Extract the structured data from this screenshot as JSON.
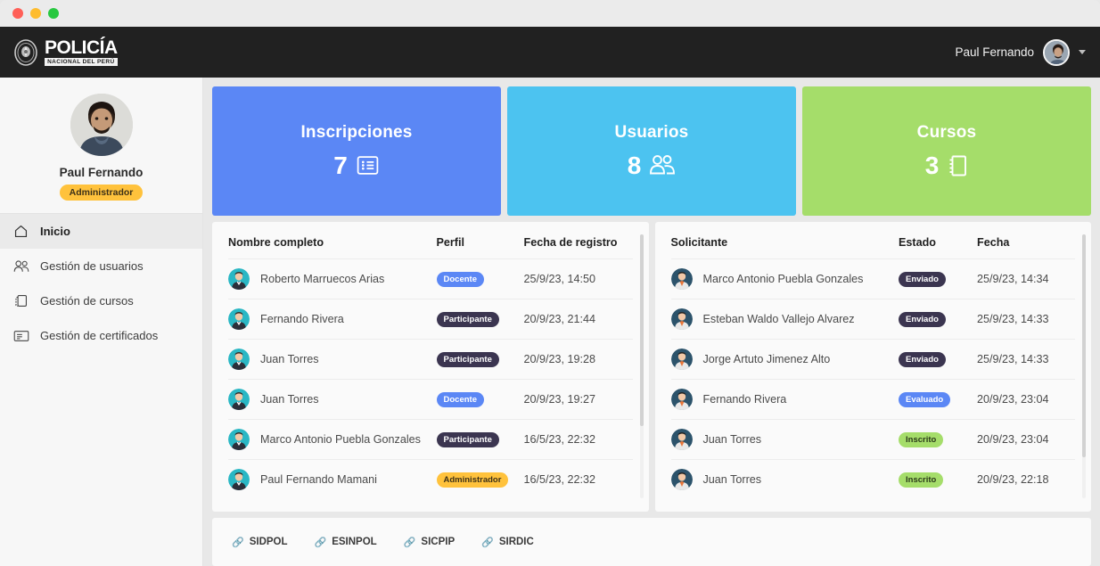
{
  "window": {
    "traffic_lights": [
      "close",
      "minimize",
      "maximize"
    ]
  },
  "topbar": {
    "brand_main": "POLICÍA",
    "brand_sub": "NACIONAL DEL PERÚ",
    "crest_icon": "police-crest-icon",
    "user_name": "Paul Fernando",
    "avatar_icon": "user-avatar",
    "caret_icon": "chevron-down-icon"
  },
  "sidebar": {
    "profile": {
      "avatar_icon": "profile-photo",
      "name": "Paul Fernando",
      "role": "Administrador"
    },
    "items": [
      {
        "label": "Inicio",
        "icon": "home-icon",
        "active": true
      },
      {
        "label": "Gestión de usuarios",
        "icon": "users-icon",
        "active": false
      },
      {
        "label": "Gestión de cursos",
        "icon": "copy-icon",
        "active": false
      },
      {
        "label": "Gestión de certificados",
        "icon": "certificate-icon",
        "active": false
      }
    ]
  },
  "cards": [
    {
      "title": "Inscripciones",
      "value": "7",
      "icon": "list-card-icon",
      "color": "#5b87f5"
    },
    {
      "title": "Usuarios",
      "value": "8",
      "icon": "users-group-icon",
      "color": "#4cc3f0"
    },
    {
      "title": "Cursos",
      "value": "3",
      "icon": "notebook-icon",
      "color": "#a5dd6a"
    }
  ],
  "users_panel": {
    "headers": [
      "Nombre completo",
      "Perfil",
      "Fecha de registro"
    ],
    "rows": [
      {
        "name": "Roberto Marruecos Arias",
        "perfil": "Docente",
        "perfil_class": "b-docente",
        "fecha": "25/9/23, 14:50"
      },
      {
        "name": "Fernando Rivera",
        "perfil": "Participante",
        "perfil_class": "b-part",
        "fecha": "20/9/23, 21:44"
      },
      {
        "name": "Juan Torres",
        "perfil": "Participante",
        "perfil_class": "b-part",
        "fecha": "20/9/23, 19:28"
      },
      {
        "name": "Juan Torres",
        "perfil": "Docente",
        "perfil_class": "b-docente",
        "fecha": "20/9/23, 19:27"
      },
      {
        "name": "Marco Antonio Puebla Gonzales",
        "perfil": "Participante",
        "perfil_class": "b-part",
        "fecha": "16/5/23, 22:32"
      },
      {
        "name": "Paul Fernando Mamani",
        "perfil": "Administrador",
        "perfil_class": "b-admin",
        "fecha": "16/5/23, 22:32"
      }
    ]
  },
  "requests_panel": {
    "headers": [
      "Solicitante",
      "Estado",
      "Fecha"
    ],
    "rows": [
      {
        "name": "Marco Antonio Puebla Gonzales",
        "estado": "Enviado",
        "estado_class": "b-enviado",
        "fecha": "25/9/23, 14:34"
      },
      {
        "name": "Esteban Waldo Vallejo Alvarez",
        "estado": "Enviado",
        "estado_class": "b-enviado",
        "fecha": "25/9/23, 14:33"
      },
      {
        "name": "Jorge Artuto Jimenez Alto",
        "estado": "Enviado",
        "estado_class": "b-enviado",
        "fecha": "25/9/23, 14:33"
      },
      {
        "name": "Fernando Rivera",
        "estado": "Evaluado",
        "estado_class": "b-evaluado",
        "fecha": "20/9/23, 23:04"
      },
      {
        "name": "Juan Torres",
        "estado": "Inscrito",
        "estado_class": "b-inscrito",
        "fecha": "20/9/23, 23:04"
      },
      {
        "name": "Juan Torres",
        "estado": "Inscrito",
        "estado_class": "b-inscrito",
        "fecha": "20/9/23, 22:18"
      }
    ]
  },
  "footer": {
    "links": [
      {
        "label": "SIDPOL",
        "icon": "link-icon"
      },
      {
        "label": "ESINPOL",
        "icon": "link-icon"
      },
      {
        "label": "SICPIP",
        "icon": "link-icon"
      },
      {
        "label": "SIRDIC",
        "icon": "link-icon"
      }
    ]
  }
}
